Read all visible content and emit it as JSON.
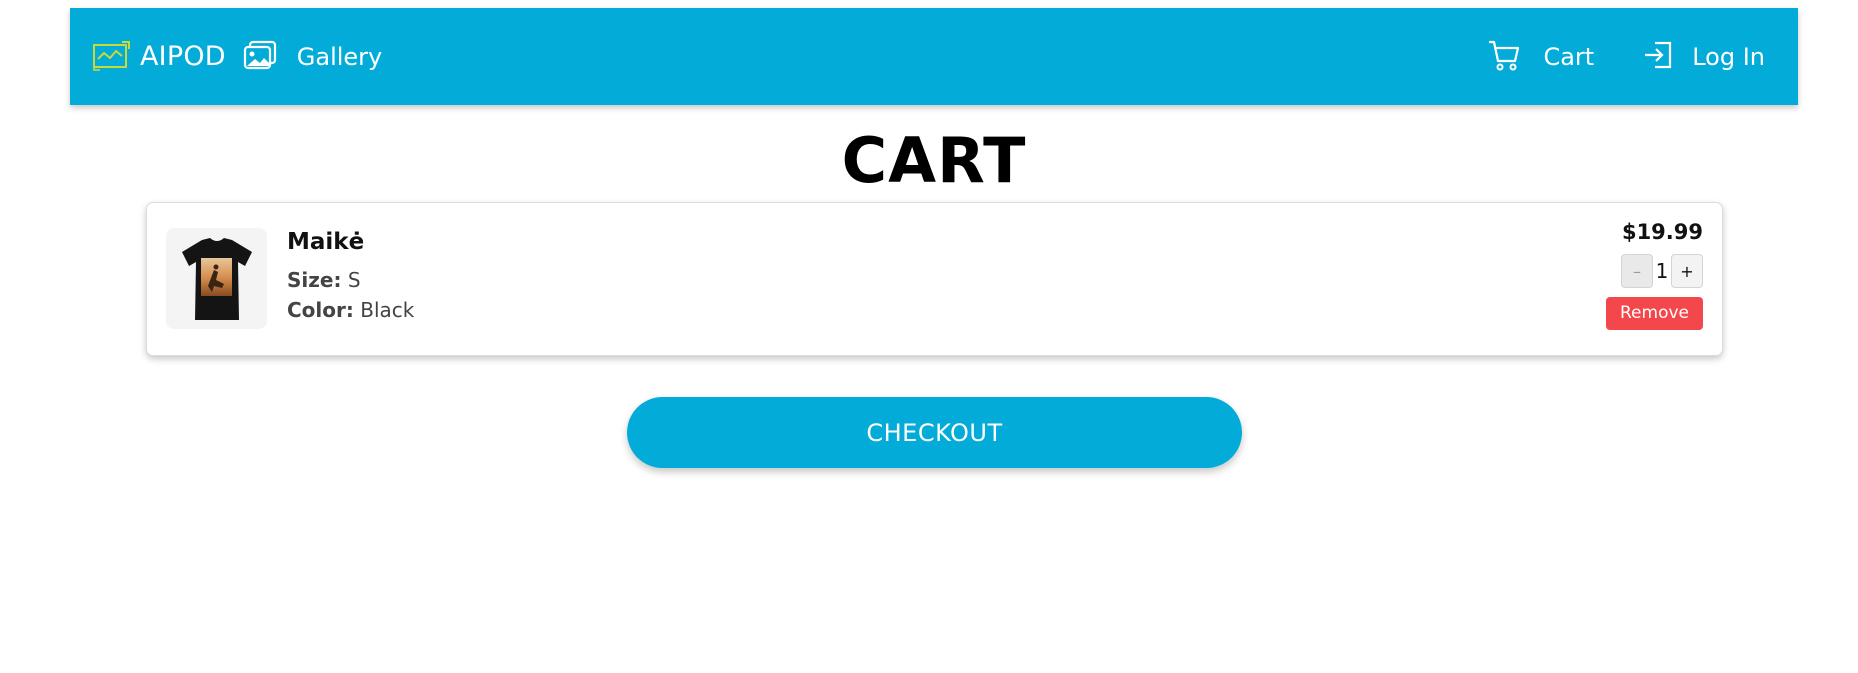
{
  "navbar": {
    "brand_label": "AIPOD",
    "brand_icon": "aipod-logo-icon",
    "gallery_label": "Gallery",
    "gallery_icon": "gallery-icon",
    "cart_label": "Cart",
    "cart_icon": "cart-icon",
    "login_label": "Log In",
    "login_icon": "login-icon",
    "background_color": "#03acd8",
    "logo_color": "#c9d93a"
  },
  "page": {
    "title": "CART"
  },
  "cart": {
    "items": [
      {
        "name": "Maikė",
        "size_label": "Size:",
        "size_value": "S",
        "color_label": "Color:",
        "color_value": "Black",
        "price": "$19.99",
        "quantity": "1",
        "decrement_label": "–",
        "increment_label": "+",
        "remove_label": "Remove",
        "thumbnail": "black-tshirt-image"
      }
    ]
  },
  "checkout": {
    "label": "CHECKOUT"
  },
  "colors": {
    "accent": "#03acd8",
    "danger": "#f4474b"
  }
}
